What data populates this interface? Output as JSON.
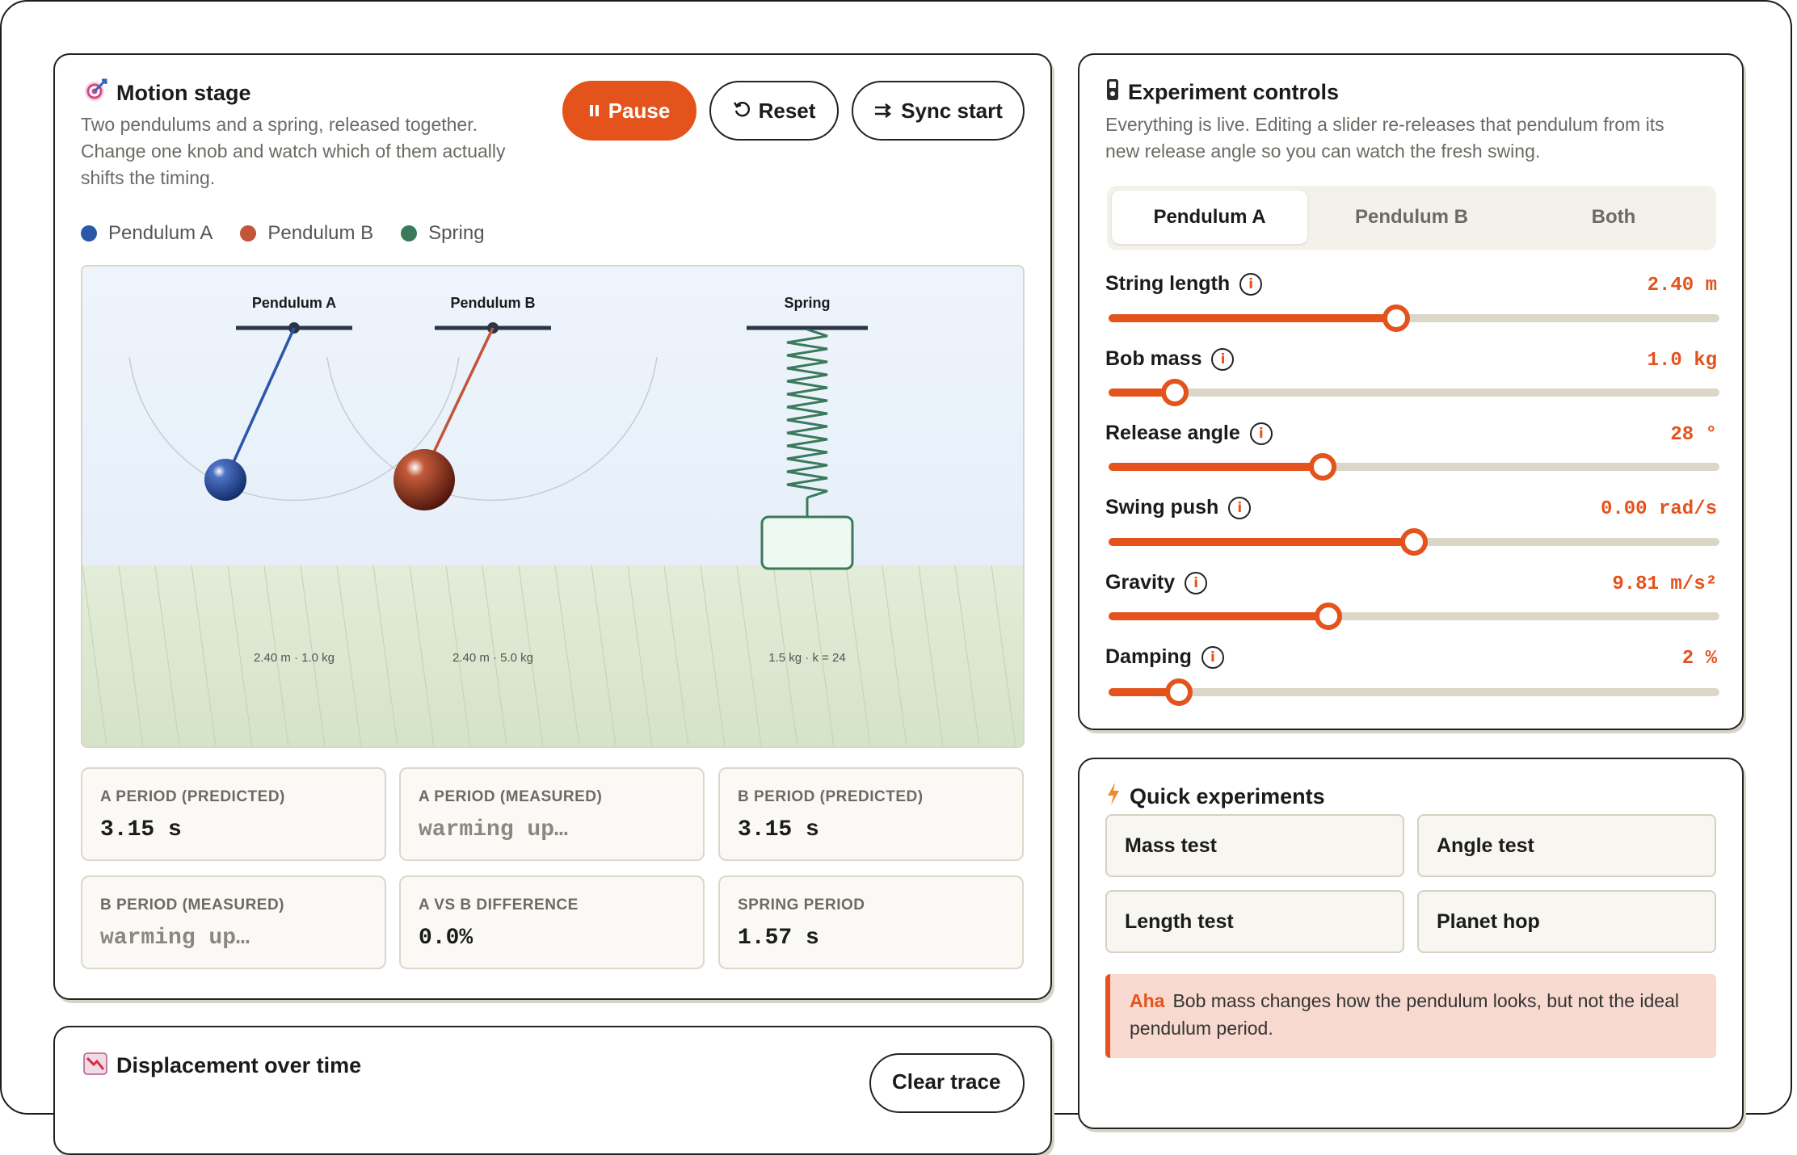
{
  "motion": {
    "title": "Motion stage",
    "subtitle_lines": [
      "Two pendulums and a spring, released together.",
      "Change one knob and watch which of them actually",
      "shifts the timing."
    ],
    "buttons": {
      "pause": "Pause",
      "reset": "Reset",
      "sync": "Sync start"
    },
    "legend": [
      {
        "label": "Pendulum A",
        "color": "#2a57a8"
      },
      {
        "label": "Pendulum B",
        "color": "#c2553a"
      },
      {
        "label": "Spring",
        "color": "#3a7a5a"
      }
    ],
    "stage": {
      "pendulum_a_title": "Pendulum A",
      "pendulum_b_title": "Pendulum B",
      "spring_title": "Spring",
      "pendulum_a_info": "2.40 m · 1.0 kg",
      "pendulum_b_info": "2.40 m · 5.0 kg",
      "spring_info": "1.5 kg · k = 24"
    },
    "stats": [
      {
        "label": "A PERIOD (PREDICTED)",
        "value": "3.15 s",
        "muted": false
      },
      {
        "label": "A PERIOD (MEASURED)",
        "value": "warming up…",
        "muted": true
      },
      {
        "label": "B PERIOD (PREDICTED)",
        "value": "3.15 s",
        "muted": false
      },
      {
        "label": "B PERIOD (MEASURED)",
        "value": "warming up…",
        "muted": true
      },
      {
        "label": "A VS B DIFFERENCE",
        "value": "0.0%",
        "muted": false
      },
      {
        "label": "SPRING PERIOD",
        "value": "1.57 s",
        "muted": false
      }
    ]
  },
  "controls": {
    "title": "Experiment controls",
    "subtitle_lines": [
      "Everything is live. Editing a slider re-releases that pendulum from its",
      "new release angle so you can watch the fresh swing."
    ],
    "tabs": [
      "Pendulum A",
      "Pendulum B",
      "Both"
    ],
    "active_tab": 0,
    "sliders": [
      {
        "label": "String length",
        "value": "2.40 m",
        "fraction": 0.471
      },
      {
        "label": "Bob mass",
        "value": "1.0 kg",
        "fraction": 0.108
      },
      {
        "label": "Release angle",
        "value": "28 °",
        "fraction": 0.35
      },
      {
        "label": "Swing push",
        "value": "0.00 rad/s",
        "fraction": 0.5
      },
      {
        "label": "Gravity",
        "value": "9.81 m/s²",
        "fraction": 0.36
      },
      {
        "label": "Damping",
        "value": "2 %",
        "fraction": 0.115
      }
    ]
  },
  "quick": {
    "title": "Quick experiments",
    "buttons": [
      "Mass test",
      "Angle test",
      "Length test",
      "Planet hop"
    ],
    "aha_tag": "Aha",
    "aha_text": "Bob mass changes how the pendulum looks, but not the ideal pendulum period."
  },
  "displacement": {
    "title": "Displacement over time",
    "button": "Clear trace"
  },
  "colors": {
    "accent": "#e4531c",
    "pendulum_a": "#2a57a8",
    "pendulum_b": "#c2553a",
    "spring": "#3a7a5a"
  }
}
